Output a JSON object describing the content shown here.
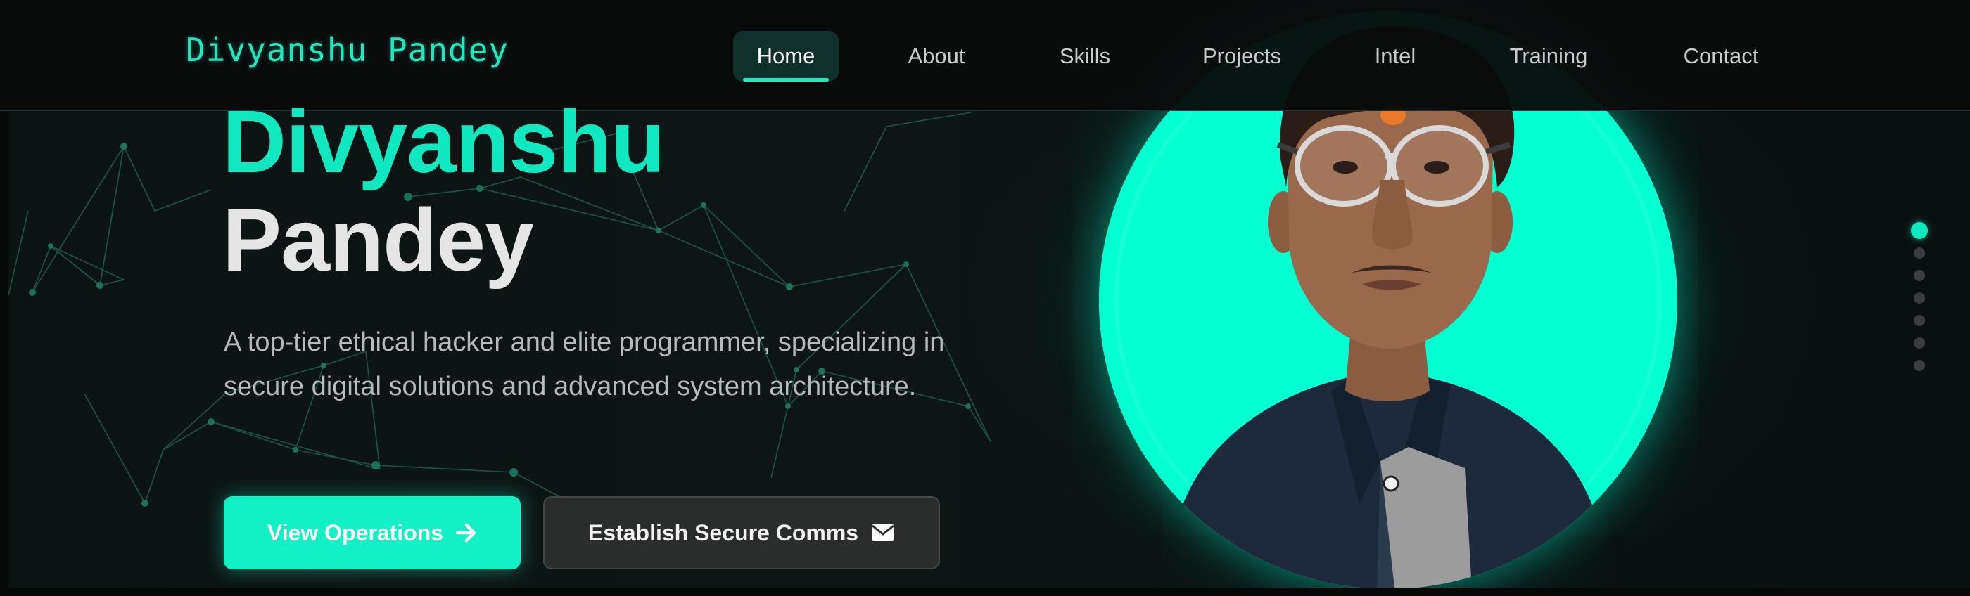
{
  "brand": {
    "name": "Divyanshu Pandey"
  },
  "nav": {
    "items": [
      {
        "label": "Home",
        "active": true
      },
      {
        "label": "About",
        "active": false
      },
      {
        "label": "Skills",
        "active": false
      },
      {
        "label": "Projects",
        "active": false
      },
      {
        "label": "Intel",
        "active": false
      },
      {
        "label": "Training",
        "active": false
      },
      {
        "label": "Contact",
        "active": false
      }
    ]
  },
  "hero": {
    "first_name": "Divyanshu",
    "last_name": "Pandey",
    "tagline": "A top-tier ethical hacker and elite programmer, specializing in secure digital solutions and advanced system architecture.",
    "primary_button": {
      "label": "View Operations",
      "icon": "arrow-right-icon"
    },
    "secondary_button": {
      "label": "Establish Secure Comms",
      "icon": "envelope-icon"
    }
  },
  "section_dots": {
    "count": 7,
    "active_index": 0
  },
  "colors": {
    "accent": "#12e8c0",
    "background": "#0b0f0f",
    "navbar": "#090b0b",
    "portrait_ring": "#04ffd0"
  }
}
